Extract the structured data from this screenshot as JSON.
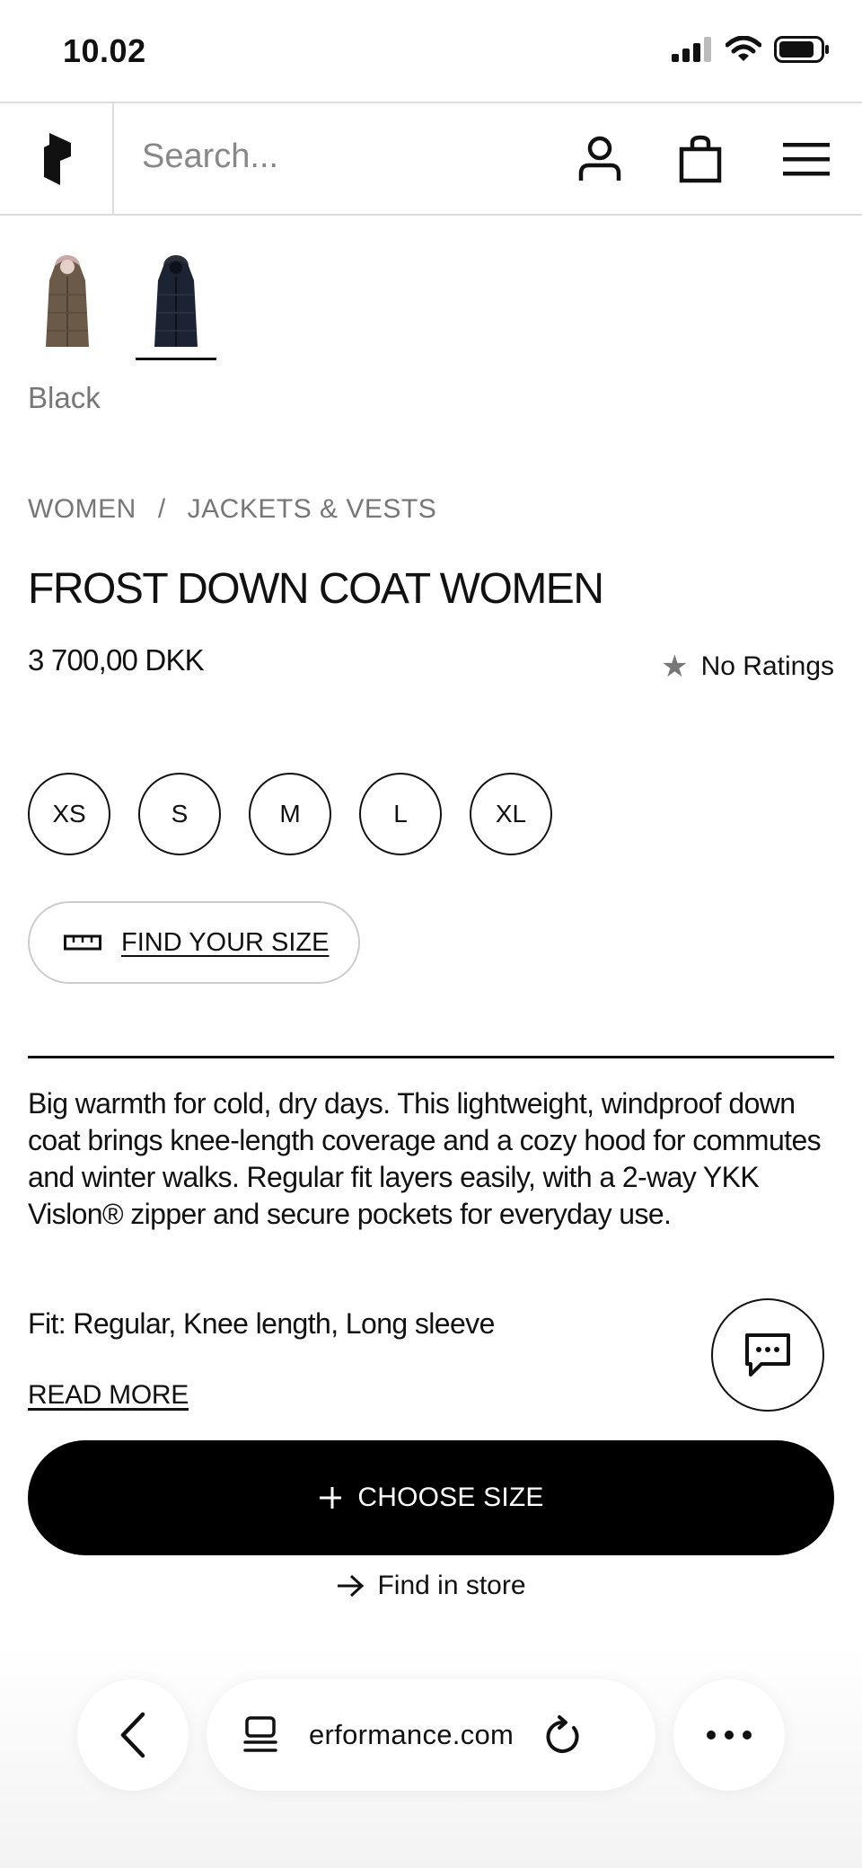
{
  "status_bar": {
    "time": "10.02"
  },
  "header": {
    "search_placeholder": "Search..."
  },
  "product": {
    "selected_color": "Black",
    "breadcrumb": [
      "WOMEN",
      "JACKETS & VESTS"
    ],
    "breadcrumb_sep": "/",
    "title": "FROST DOWN COAT WOMEN",
    "price": "3 700,00 DKK",
    "rating_text": "No Ratings",
    "sizes": [
      "XS",
      "S",
      "M",
      "L",
      "XL"
    ],
    "find_size_label": "FIND YOUR SIZE",
    "description": "Big warmth for cold, dry days. This lightweight, windproof down coat brings knee-length coverage and a cozy hood for commutes and winter walks. Regular fit layers easily, with a 2-way YKK Vislon® zipper and secure pockets for everyday use.",
    "fit": "Fit: Regular, Knee length, Long sleeve",
    "read_more": "READ MORE",
    "choose_size": "CHOOSE SIZE",
    "find_in_store": "Find in store"
  },
  "browser": {
    "url": "erformance.com"
  },
  "colors": {
    "accent": "#000000",
    "muted": "#777777",
    "border": "#dddddd",
    "swatch_brown": "#6b5a48",
    "swatch_navy": "#1c2333"
  },
  "icons": [
    "logo-icon",
    "user-icon",
    "bag-icon",
    "menu-icon",
    "ruler-icon",
    "star-icon",
    "chat-icon",
    "plus-icon",
    "arrow-right-icon",
    "back-icon",
    "tabs-icon",
    "reload-icon",
    "more-icon"
  ]
}
